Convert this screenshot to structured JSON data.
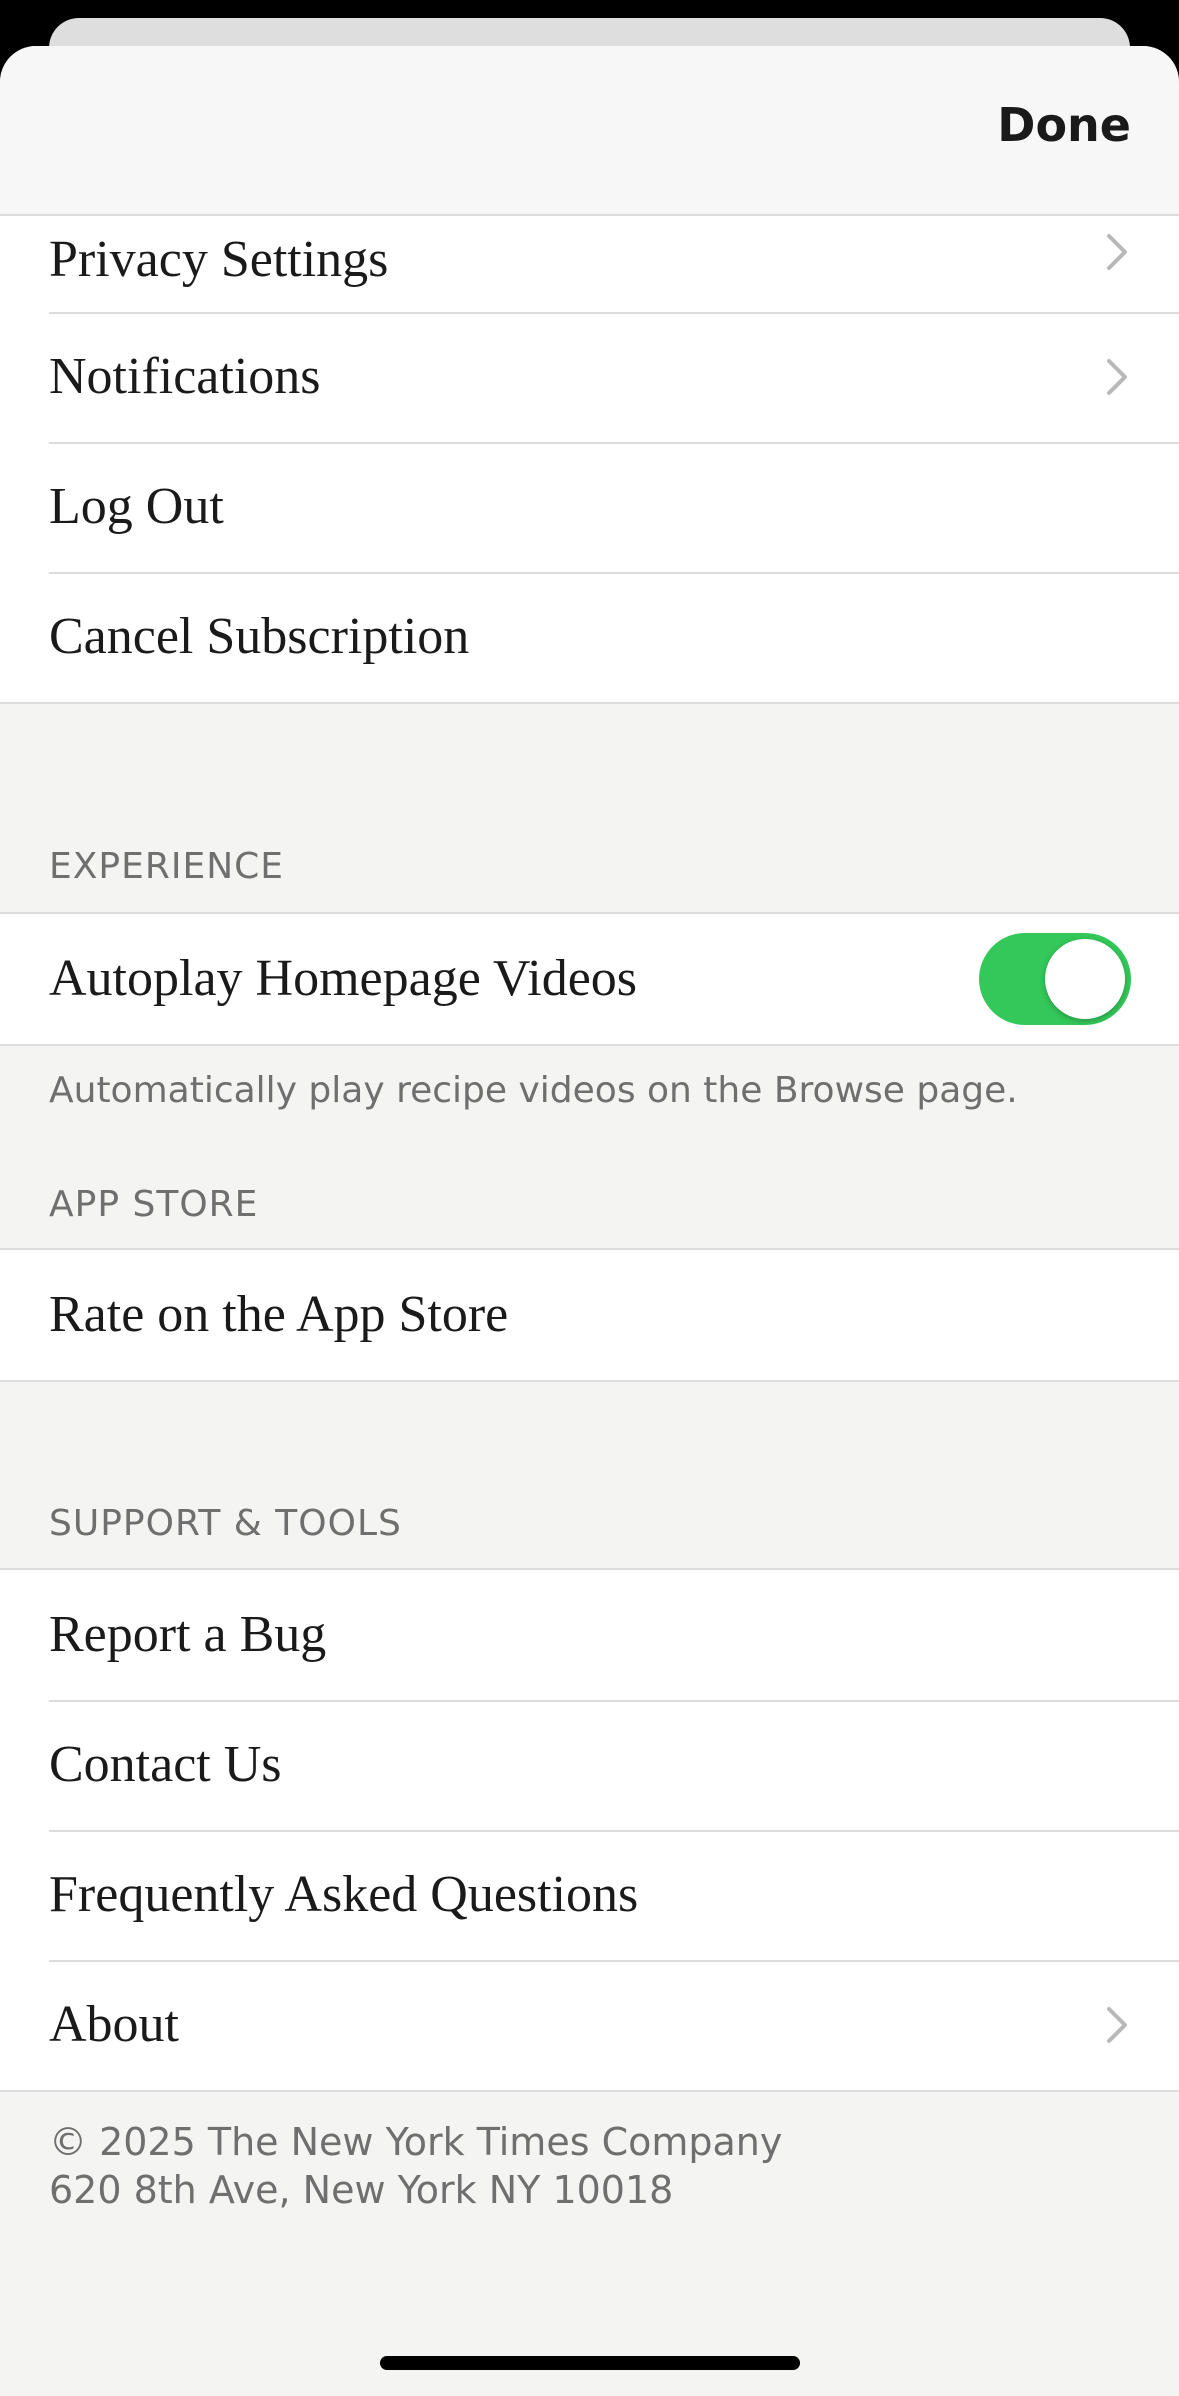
{
  "nav": {
    "done_label": "Done"
  },
  "account": {
    "items": [
      {
        "label": "Privacy Settings",
        "chevron": true,
        "icon": "chevron-right-icon"
      },
      {
        "label": "Notifications",
        "chevron": true,
        "icon": "chevron-right-icon"
      },
      {
        "label": "Log Out",
        "chevron": false
      },
      {
        "label": "Cancel Subscription",
        "chevron": false
      }
    ]
  },
  "experience": {
    "header": "EXPERIENCE",
    "autoplay_label": "Autoplay Homepage Videos",
    "autoplay_enabled": true,
    "footnote": "Automatically play recipe videos on the Browse page."
  },
  "app_store": {
    "header": "APP STORE",
    "rate_label": "Rate on the App Store"
  },
  "support": {
    "header": "SUPPORT & TOOLS",
    "items": [
      {
        "label": "Report a Bug",
        "chevron": false
      },
      {
        "label": "Contact Us",
        "chevron": false
      },
      {
        "label": "Frequently Asked Questions",
        "chevron": false
      },
      {
        "label": "About",
        "chevron": true,
        "icon": "chevron-right-icon"
      }
    ]
  },
  "footer": {
    "copyright_line1": "© 2025 The New York Times Company",
    "copyright_line2": "620 8th Ave, New York NY 10018"
  },
  "colors": {
    "toggle_on": "#34c759",
    "background": "#f4f4f3",
    "text_primary": "#1a1a1a",
    "text_secondary": "#6f6f6f"
  }
}
